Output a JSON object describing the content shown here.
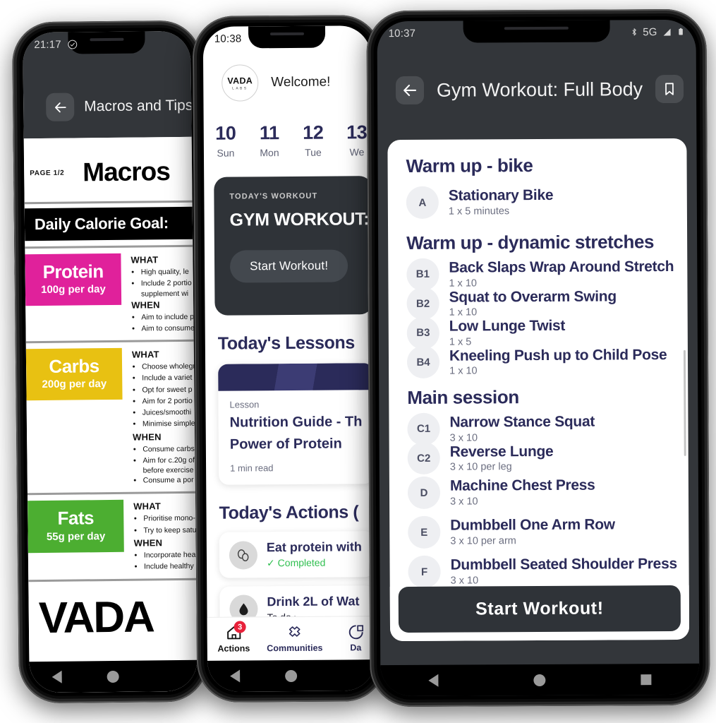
{
  "colors": {
    "navy": "#2b2b5a",
    "dark_chrome": "#33363a",
    "card_dark": "#2f3338",
    "protein_pink": "#e0219b",
    "carbs_yellow": "#e8c112",
    "fats_green": "#4cae31",
    "completed_green": "#2fbf4f",
    "badge_red": "#e8213a"
  },
  "phone1": {
    "status": {
      "time": "21:17",
      "icon": "check-circle-icon"
    },
    "appbar": {
      "back_icon": "back-arrow-icon",
      "title": "Macros and Tips_"
    },
    "document": {
      "page_label": "PAGE 1/2",
      "heading": "Macros",
      "calorie_bar": "Daily Calorie Goal:",
      "macros": [
        {
          "name": "Protein",
          "amount": "100g per day",
          "color": "#e0219b",
          "what_label": "WHAT",
          "what": [
            "High quality, le",
            "Include 2 portio",
            "supplement wi"
          ],
          "when_label": "WHEN",
          "when": [
            "Aim to include p",
            "Aim to consume"
          ]
        },
        {
          "name": "Carbs",
          "amount": "200g per day",
          "color": "#e8c112",
          "what_label": "WHAT",
          "what": [
            "Choose wholegr",
            "Include a variet",
            "Opt for sweet p",
            "Aim for 2 portio",
            "Juices/smoothi",
            "Minimise simple"
          ],
          "when_label": "WHEN",
          "when": [
            "Consume carbs",
            "Aim for c.20g of",
            "before exercise",
            "Consume a por"
          ]
        },
        {
          "name": "Fats",
          "amount": "55g per day",
          "color": "#4cae31",
          "what_label": "WHAT",
          "what": [
            "Prioritise mono-",
            "Try to keep satu"
          ],
          "when_label": "WHEN",
          "when": [
            "Incorporate hea",
            "Include healthy"
          ]
        }
      ],
      "footer_brand": "VADA"
    }
  },
  "phone2": {
    "status": {
      "time": "10:38"
    },
    "brand": {
      "logo_line1": "VADA",
      "logo_line2": "LABS",
      "welcome": "Welcome!"
    },
    "dates": [
      {
        "num": "10",
        "dow": "Sun"
      },
      {
        "num": "11",
        "dow": "Mon"
      },
      {
        "num": "12",
        "dow": "Tue"
      },
      {
        "num": "13",
        "dow": "We"
      }
    ],
    "workout_card": {
      "kicker": "TODAY'S WORKOUT",
      "title": "GYM WORKOUT: F",
      "button": "Start Workout!"
    },
    "lessons_heading": "Today's Lessons",
    "lesson": {
      "kind": "Lesson",
      "title_line1": "Nutrition Guide - Th",
      "title_line2": "Power of Protein",
      "read_time": "1 min read"
    },
    "actions_heading": "Today's Actions (",
    "actions": [
      {
        "icon": "eggs-icon",
        "title": "Eat protein with",
        "status": "✓ Completed",
        "state": "completed"
      },
      {
        "icon": "water-drop-icon",
        "title": "Drink 2L of Wat",
        "status": "To do ›",
        "state": "todo"
      }
    ],
    "tabs": [
      {
        "label": "Actions",
        "icon": "home-icon",
        "badge": "3",
        "active": true
      },
      {
        "label": "Communities",
        "icon": "community-icon",
        "badge": "",
        "active": false
      },
      {
        "label": "Da",
        "icon": "dashboard-icon",
        "badge": "",
        "active": false
      }
    ]
  },
  "phone3": {
    "status": {
      "time": "10:37",
      "bluetooth_icon": "bluetooth-icon",
      "network": "5G",
      "signal_icon": "signal-icon",
      "battery_icon": "battery-icon"
    },
    "appbar": {
      "back_icon": "back-arrow-icon",
      "title": "Gym Workout: Full Body",
      "bookmark_icon": "bookmark-icon"
    },
    "groups": [
      {
        "heading": "Warm up - bike",
        "exercises": [
          {
            "badge": "A",
            "name": "Stationary Bike",
            "sets": "1 x 5 minutes",
            "linked": false
          }
        ]
      },
      {
        "heading": "Warm up - dynamic stretches",
        "exercises": [
          {
            "badge": "B1",
            "name": "Back Slaps Wrap Around Stretch",
            "sets": "1 x 10",
            "linked": true
          },
          {
            "badge": "B2",
            "name": "Squat to Overarm Swing",
            "sets": "1 x 10",
            "linked": true
          },
          {
            "badge": "B3",
            "name": "Low Lunge Twist",
            "sets": "1 x 5",
            "linked": true
          },
          {
            "badge": "B4",
            "name": "Kneeling Push up to Child Pose",
            "sets": "1 x 10",
            "linked": true
          }
        ]
      },
      {
        "heading": "Main session",
        "exercises": [
          {
            "badge": "C1",
            "name": "Narrow Stance Squat",
            "sets": "3 x 10",
            "linked": true
          },
          {
            "badge": "C2",
            "name": "Reverse Lunge",
            "sets": "3 x 10 per leg",
            "linked": true
          },
          {
            "badge": "D",
            "name": "Machine Chest Press",
            "sets": "3 x 10",
            "linked": false
          },
          {
            "badge": "E",
            "name": "Dumbbell One Arm Row",
            "sets": "3 x 10 per arm",
            "linked": false
          },
          {
            "badge": "F",
            "name": "Dumbbell Seated Shoulder Press",
            "sets": "3 x 10",
            "linked": false
          }
        ]
      }
    ],
    "start_button": "Start Workout!"
  }
}
